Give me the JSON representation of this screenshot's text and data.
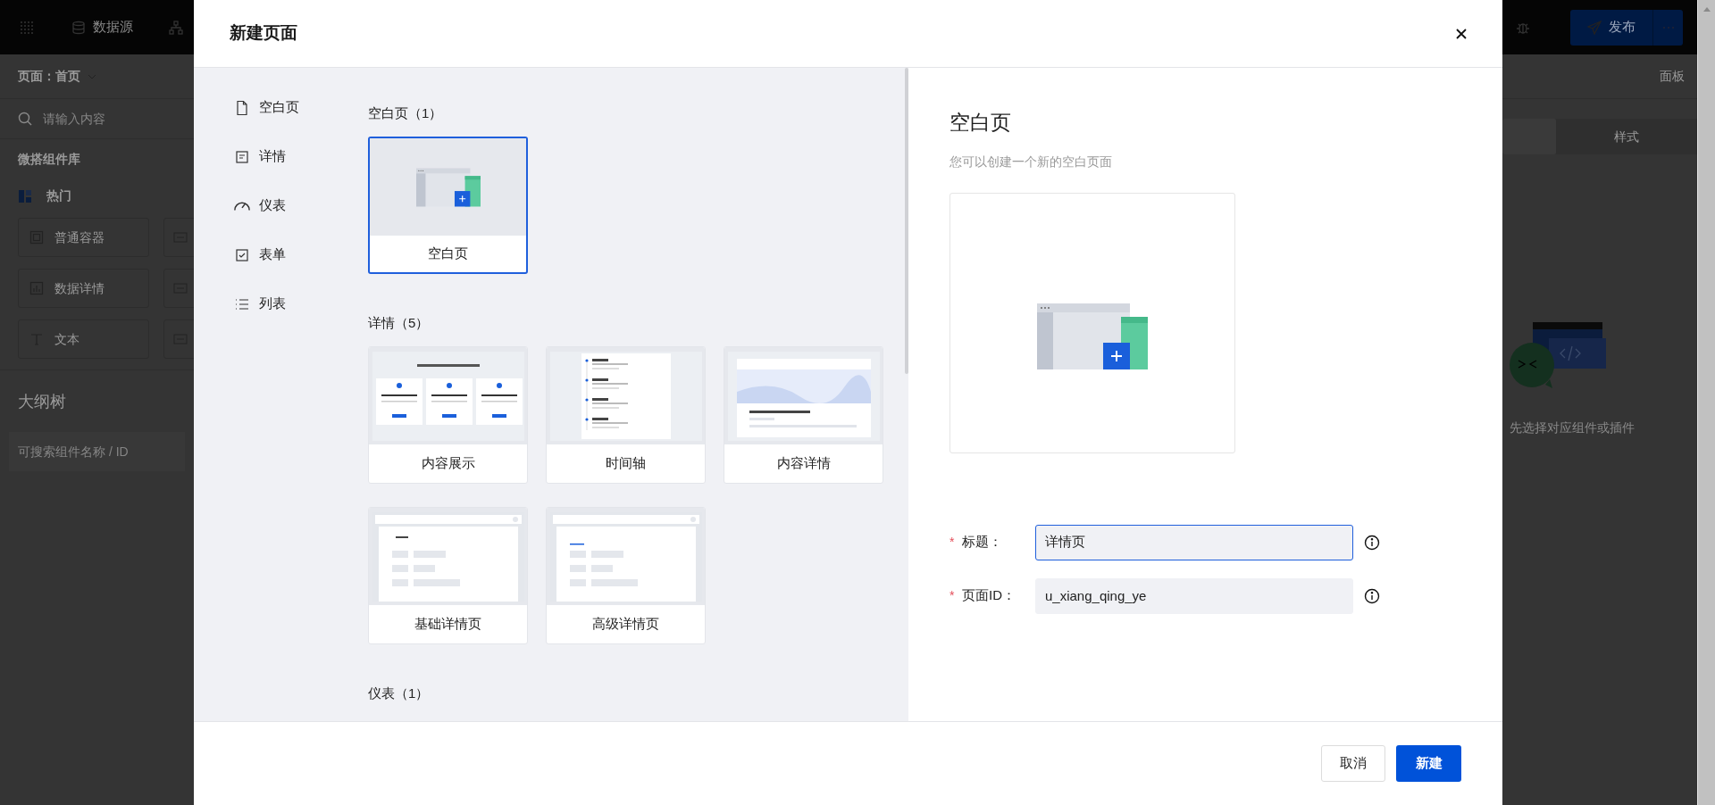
{
  "app": {
    "topbar": {
      "datasource": "数据源",
      "publish": "发布"
    },
    "left_panel": {
      "page_select": "页面：首页",
      "search": {
        "placeholder": "请输入内容"
      },
      "library_title": "微搭组件库",
      "category": "热门",
      "components": [
        {
          "label": "普通容器",
          "kind": "container"
        },
        {
          "label": "数据详情",
          "kind": "chart"
        },
        {
          "label": "文本",
          "kind": "text"
        }
      ],
      "outline_title": "大纲树",
      "outline_search": {
        "placeholder": "可搜索组件名称 / ID"
      }
    },
    "right_panel": {
      "title": "面板",
      "tabs": [
        {
          "label": "样式"
        }
      ],
      "empty_text": "先选择对应组件或插件"
    }
  },
  "dialog": {
    "title": "新建页面",
    "nav": [
      {
        "label": "空白页",
        "kind": "file"
      },
      {
        "label": "详情",
        "kind": "detail"
      },
      {
        "label": "仪表",
        "kind": "gauge"
      },
      {
        "label": "表单",
        "kind": "form"
      },
      {
        "label": "列表",
        "kind": "list"
      }
    ],
    "sections": [
      {
        "title": "空白页（1）",
        "templates": [
          {
            "label": "空白页",
            "kind": "blank",
            "selected": true
          }
        ]
      },
      {
        "title": "详情（5）",
        "templates": [
          {
            "label": "内容展示",
            "kind": "cards",
            "selected": false
          },
          {
            "label": "时间轴",
            "kind": "timeline",
            "selected": false
          },
          {
            "label": "内容详情",
            "kind": "article",
            "selected": false
          },
          {
            "label": "基础详情页",
            "kind": "basic",
            "selected": false
          },
          {
            "label": "高级详情页",
            "kind": "advanced",
            "selected": false
          }
        ]
      },
      {
        "title": "仪表（1）"
      }
    ],
    "preview": {
      "title": "空白页",
      "description": "您可以创建一个新的空白页面"
    },
    "form": {
      "fields": [
        {
          "required_mark": "*",
          "label": "标题：",
          "value": "详情页",
          "focused": true
        },
        {
          "required_mark": "*",
          "label": "页面ID：",
          "value": "u_xiang_qing_ye",
          "focused": false
        }
      ]
    },
    "buttons": [
      {
        "label": "取消",
        "kind": "default"
      },
      {
        "label": "新建",
        "kind": "primary"
      }
    ]
  }
}
